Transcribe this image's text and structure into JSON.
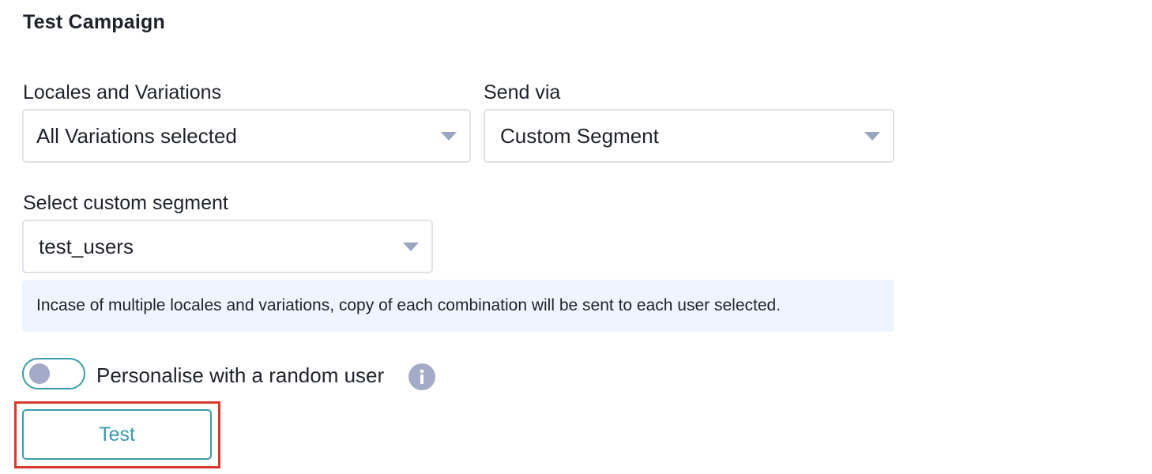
{
  "page": {
    "title": "Test Campaign"
  },
  "form": {
    "locales": {
      "label": "Locales and Variations",
      "value": "All Variations selected"
    },
    "send_via": {
      "label": "Send via",
      "value": "Custom Segment"
    },
    "segment": {
      "label": "Select custom segment",
      "value": "test_users"
    },
    "note": "Incase of multiple locales and variations, copy of each combination will be sent to each user selected.",
    "personalise": {
      "label": "Personalise with a random user",
      "enabled": false,
      "info_icon": "info-icon"
    },
    "test_button_label": "Test"
  },
  "colors": {
    "accent": "#3b9cad",
    "muted_icon": "#a3abc9",
    "note_background": "#eef5fe",
    "border": "#dfe3e8",
    "highlight": "#d93a2f"
  }
}
